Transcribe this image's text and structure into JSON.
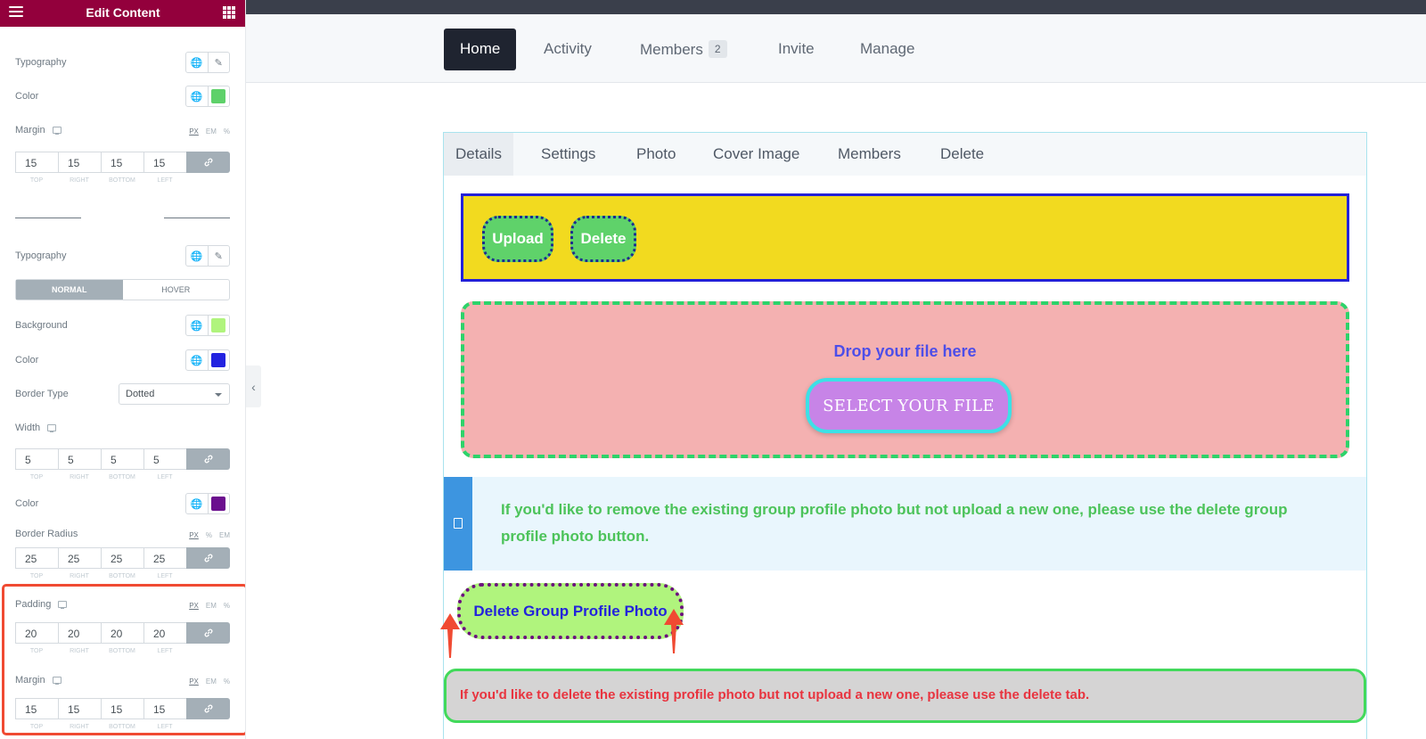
{
  "sidebar": {
    "title": "Edit Content",
    "typography1": "Typography",
    "color1": "Color",
    "margin1": {
      "label": "Margin",
      "units": [
        "PX",
        "EM",
        "%"
      ],
      "values": [
        "15",
        "15",
        "15",
        "15"
      ]
    },
    "dim_labels": [
      "TOP",
      "RIGHT",
      "BOTTOM",
      "LEFT"
    ],
    "typography2": "Typography",
    "state_tabs": {
      "normal": "NORMAL",
      "hover": "HOVER"
    },
    "background": "Background",
    "color2": "Color",
    "border_type": {
      "label": "Border Type",
      "value": "Dotted"
    },
    "width": {
      "label": "Width",
      "values": [
        "5",
        "5",
        "5",
        "5"
      ]
    },
    "color3": "Color",
    "border_radius": {
      "label": "Border Radius",
      "units": [
        "PX",
        "%",
        "EM"
      ],
      "values": [
        "25",
        "25",
        "25",
        "25"
      ]
    },
    "padding": {
      "label": "Padding",
      "units": [
        "PX",
        "EM",
        "%"
      ],
      "values": [
        "20",
        "20",
        "20",
        "20"
      ]
    },
    "margin2": {
      "label": "Margin",
      "units": [
        "PX",
        "EM",
        "%"
      ],
      "values": [
        "15",
        "15",
        "15",
        "15"
      ]
    },
    "colors": {
      "header": "#93003c",
      "color1": "#5ed16a",
      "background": "#b0f47d",
      "color2": "#2323e0",
      "color3": "#6b0f8e",
      "highlight": "#f04a32"
    }
  },
  "nav": {
    "items": [
      "Home",
      "Activity",
      "Members",
      "Invite",
      "Manage"
    ],
    "members_count": "2"
  },
  "subtabs": [
    "Details",
    "Settings",
    "Photo",
    "Cover Image",
    "Members",
    "Delete"
  ],
  "content": {
    "upload_label": "Upload",
    "delete_label": "Delete",
    "drop_text": "Drop your file here",
    "select_file_label": "SELECT YOUR FILE",
    "info_text": "If you'd like to remove the existing group profile photo but not upload a new one, please use the delete group profile photo button.",
    "delete_photo_label": "Delete Group Profile Photo",
    "notice_text": "If you'd like to delete the existing profile photo but not upload a new one, please use the delete tab."
  }
}
